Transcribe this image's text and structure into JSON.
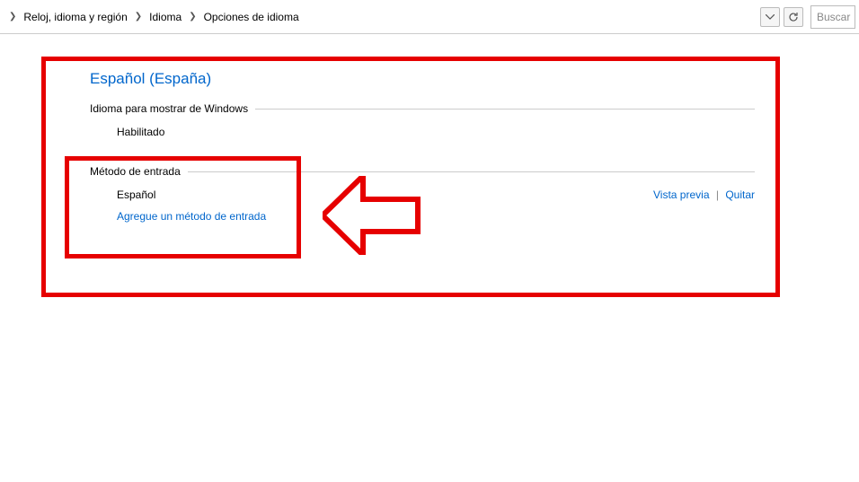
{
  "breadcrumb": {
    "items": [
      "Reloj, idioma y región",
      "Idioma",
      "Opciones de idioma"
    ]
  },
  "search": {
    "placeholder": "Buscar"
  },
  "heading": "Español (España)",
  "display_lang_section": {
    "label": "Idioma para mostrar de Windows",
    "status": "Habilitado"
  },
  "input_method_section": {
    "label": "Método de entrada",
    "method": "Español",
    "preview_label": "Vista previa",
    "remove_label": "Quitar",
    "add_label": "Agregue un método de entrada"
  }
}
